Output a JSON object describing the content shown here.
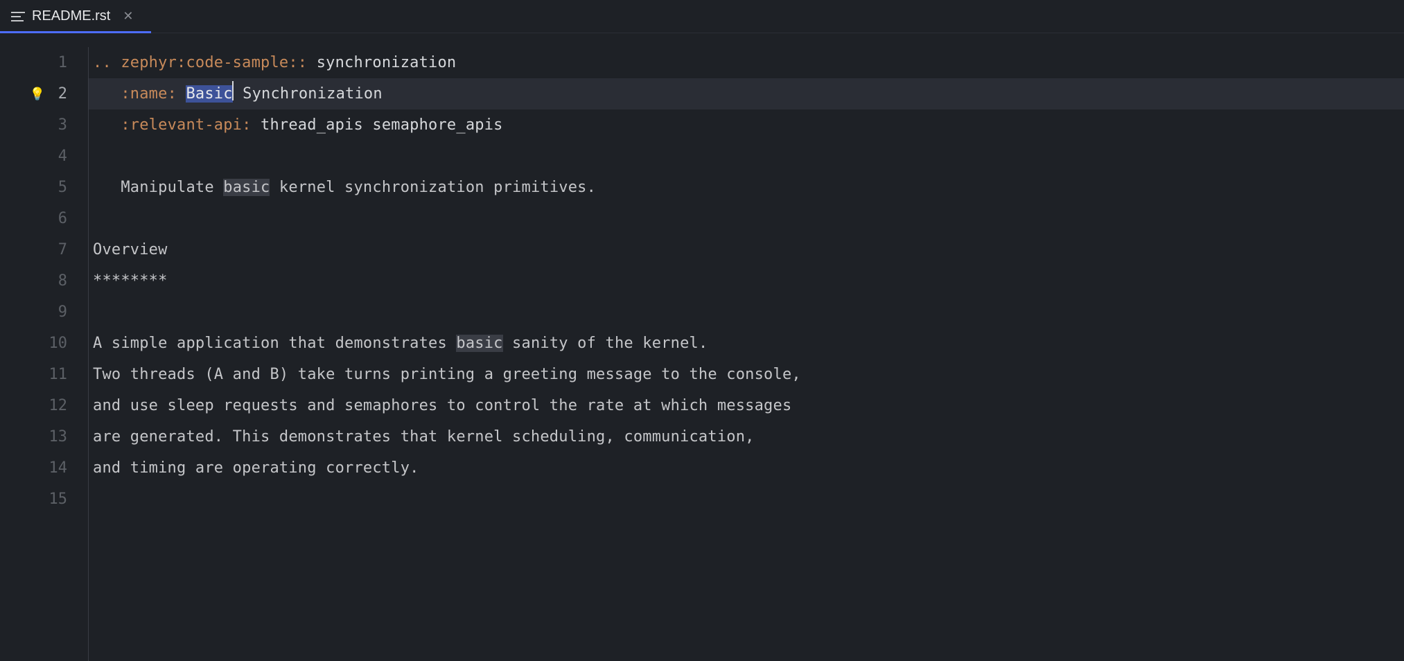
{
  "tab": {
    "filename": "README.rst"
  },
  "editor": {
    "lineNumbers": [
      "1",
      "2",
      "3",
      "4",
      "5",
      "6",
      "7",
      "8",
      "9",
      "10",
      "11",
      "12",
      "13",
      "14",
      "15"
    ],
    "activeLine": 2,
    "bulbLine": 2,
    "lines": {
      "l1": {
        "prefix": ".. ",
        "directive": "zephyr:code-sample",
        "colons": ":: ",
        "arg": "synchronization"
      },
      "l2": {
        "indent": "   ",
        "field": ":name:",
        "gap": " ",
        "selected": "Basic",
        "rest": " Synchronization"
      },
      "l3": {
        "indent": "   ",
        "field": ":relevant-api:",
        "gap": " ",
        "arg": "thread_apis semaphore_apis"
      },
      "l5": {
        "indent": "   ",
        "pre": "Manipulate ",
        "match": "basic",
        "post": " kernel synchronization primitives."
      },
      "l7": "Overview",
      "l8": "********",
      "l10": {
        "pre": "A simple application that demonstrates ",
        "match": "basic",
        "post": " sanity of the kernel."
      },
      "l11": "Two threads (A and B) take turns printing a greeting message to the console,",
      "l12": "and use sleep requests and semaphores to control the rate at which messages",
      "l13": "are generated. This demonstrates that kernel scheduling, communication,",
      "l14": "and timing are operating correctly."
    }
  }
}
